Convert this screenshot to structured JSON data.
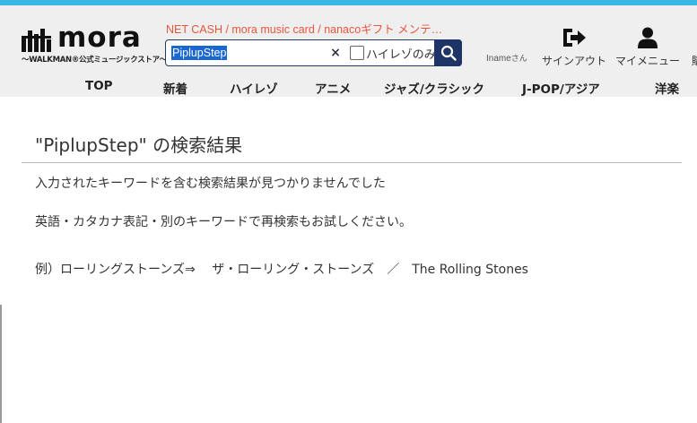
{
  "header": {
    "logo_tagline": "〜WALKMAN®公式ミュージックストア〜",
    "logo_word": "mora",
    "notice": "NET CASH / mora music card / nanacoギフト メンテ…",
    "search": {
      "query": "PiplupStep",
      "hires_label": "ハイレゾのみ",
      "hires_checked": false
    },
    "user": {
      "name": "Iname",
      "suffix": "さん"
    },
    "signout_label": "サインアウト",
    "mypage_label": "マイメニュー",
    "more_label": "購"
  },
  "nav": {
    "items": [
      "TOP",
      "新着",
      "ハイレゾ",
      "アニメ",
      "ジャズ/クラシック",
      "J-POP/アジア",
      "洋楽"
    ]
  },
  "results": {
    "title": "\"PiplupStep\" の検索結果",
    "no_results": "入力されたキーワードを含む検索結果が見つかりませんでした",
    "suggestion": "英語・カタカナ表記・別のキーワードで再検索もお試しください。",
    "example": "例）ローリングストーンズ⇒　 ザ・ローリング・ストーンズ　／　The Rolling Stones"
  },
  "colors": {
    "accent_top": "#39b8e6",
    "notice": "#e8553d",
    "search_button": "#1e3466",
    "selection": "#1967d2"
  },
  "icons": {
    "signout": "sign-out-icon",
    "mypage": "user-icon",
    "search": "search-icon",
    "clear": "close-icon"
  }
}
